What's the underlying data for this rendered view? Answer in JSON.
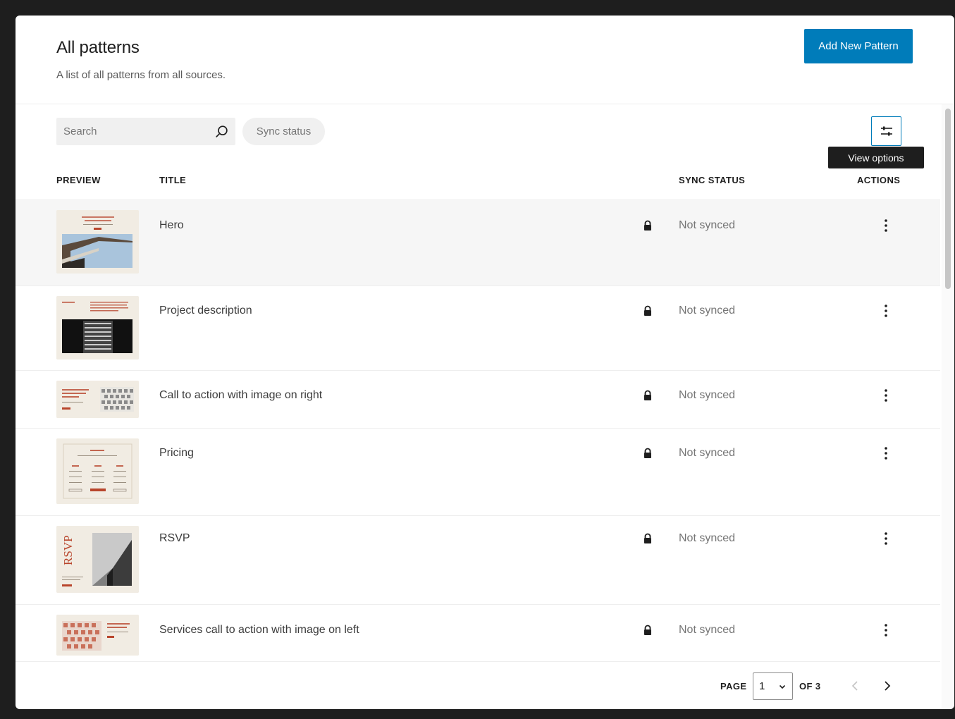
{
  "header": {
    "title": "All patterns",
    "subtitle": "A list of all patterns from all sources.",
    "add_button": "Add New Pattern"
  },
  "toolbar": {
    "search_placeholder": "Search",
    "sync_filter": "Sync status",
    "view_options_tooltip": "View options"
  },
  "columns": {
    "preview": "PREVIEW",
    "title": "TITLE",
    "sync_status": "SYNC STATUS",
    "actions": "ACTIONS"
  },
  "rows": [
    {
      "title": "Hero",
      "sync_status": "Not synced",
      "locked": true,
      "selected": true,
      "thumb": "hero"
    },
    {
      "title": "Project description",
      "sync_status": "Not synced",
      "locked": true,
      "selected": false,
      "thumb": "project"
    },
    {
      "title": "Call to action with image on right",
      "sync_status": "Not synced",
      "locked": true,
      "selected": false,
      "thumb": "cta-right"
    },
    {
      "title": "Pricing",
      "sync_status": "Not synced",
      "locked": true,
      "selected": false,
      "thumb": "pricing"
    },
    {
      "title": "RSVP",
      "sync_status": "Not synced",
      "locked": true,
      "selected": false,
      "thumb": "rsvp",
      "thumb_text": "RSVP"
    },
    {
      "title": "Services call to action with image on left",
      "sync_status": "Not synced",
      "locked": true,
      "selected": false,
      "thumb": "services-left"
    }
  ],
  "pagination": {
    "page_label": "PAGE",
    "current_page": "1",
    "of_label": "OF 3"
  },
  "icons": {
    "search": "search-icon",
    "view_options": "sliders-icon",
    "lock": "lock-icon",
    "more": "more-vertical-icon",
    "prev": "chevron-left-icon",
    "next": "chevron-right-icon"
  },
  "colors": {
    "accent": "#007cba",
    "thumb_bg": "#f1ece3",
    "thumb_accent": "#b8452c"
  }
}
